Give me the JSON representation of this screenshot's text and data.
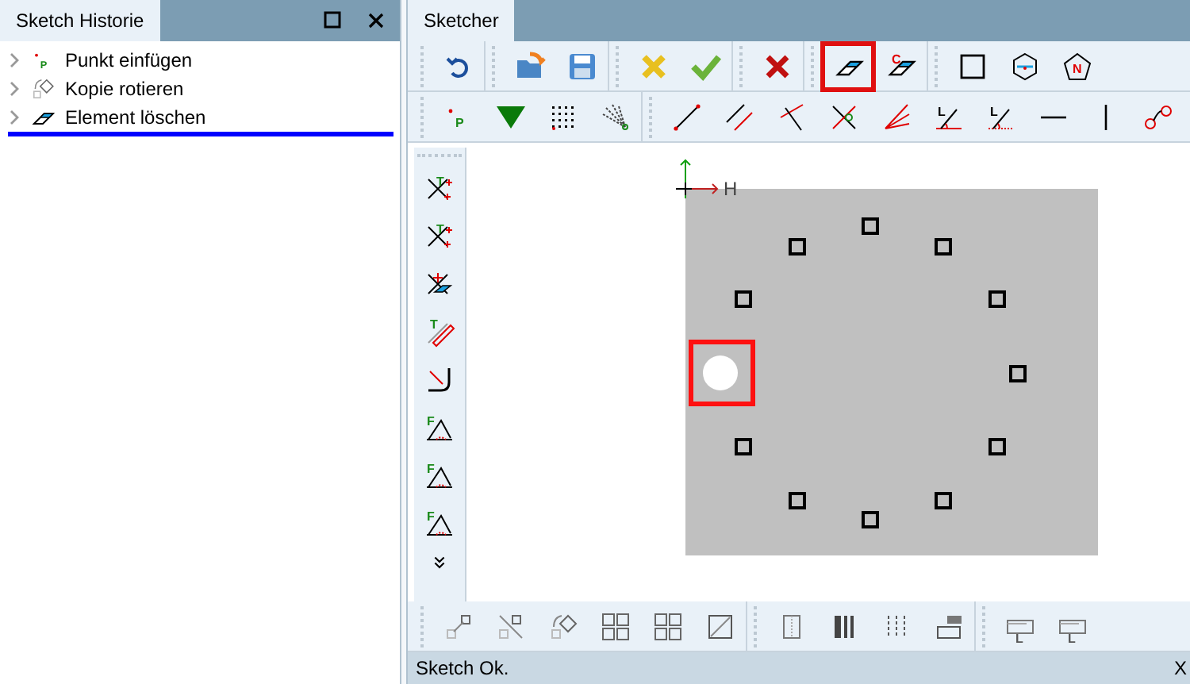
{
  "history_panel": {
    "title": "Sketch Historie",
    "items": [
      {
        "label": "Punkt einfügen",
        "kind": "point",
        "letter": "P",
        "expanded": false,
        "selected": false
      },
      {
        "label": "Kopie rotieren",
        "kind": "rotate",
        "expanded": false,
        "selected": false
      },
      {
        "label": "Element löschen",
        "kind": "eraser",
        "expanded": false,
        "selected": true
      }
    ]
  },
  "sketcher": {
    "tab": "Sketcher",
    "toolbar_1": [
      [
        {
          "kind": "undo"
        }
      ],
      [
        {
          "kind": "open"
        },
        {
          "kind": "save"
        }
      ],
      [
        {
          "kind": "cancel"
        },
        {
          "kind": "check"
        }
      ],
      [
        {
          "kind": "delete"
        }
      ],
      [
        {
          "kind": "eraser",
          "highlighted": true
        },
        {
          "kind": "eraser-c",
          "letter": "C",
          "highlighted": false
        }
      ],
      [
        {
          "kind": "square"
        },
        {
          "kind": "hexagon"
        },
        {
          "kind": "pentagon",
          "letter": "N"
        }
      ]
    ],
    "toolbar_2": [
      [
        {
          "kind": "point",
          "letter": "P"
        },
        {
          "kind": "triangle"
        },
        {
          "kind": "grid"
        },
        {
          "kind": "fan"
        }
      ],
      [
        {
          "kind": "line"
        },
        {
          "kind": "parallel"
        },
        {
          "kind": "perp"
        },
        {
          "kind": "cross"
        },
        {
          "kind": "rays"
        },
        {
          "kind": "angle",
          "letter": "L"
        },
        {
          "kind": "angle-dotted",
          "letter": "L"
        },
        {
          "kind": "hline"
        },
        {
          "kind": "vline"
        },
        {
          "kind": "circles"
        }
      ]
    ],
    "side_toolbar": [
      {
        "kind": "trim",
        "letter": "T"
      },
      {
        "kind": "trim",
        "letter": "T"
      },
      {
        "kind": "trim-erase"
      },
      {
        "kind": "offset",
        "letter": "T"
      },
      {
        "kind": "fillet"
      },
      {
        "kind": "chamfer",
        "letter": "F"
      },
      {
        "kind": "chamfer",
        "letter": "F"
      },
      {
        "kind": "chamfer",
        "letter": "F"
      },
      {
        "kind": "more"
      }
    ],
    "bottom_toolbar": [
      [
        {
          "kind": "move"
        },
        {
          "kind": "mirror"
        },
        {
          "kind": "rotate"
        },
        {
          "kind": "array"
        },
        {
          "kind": "array"
        },
        {
          "kind": "scale"
        }
      ],
      [
        {
          "kind": "panel"
        },
        {
          "kind": "bars"
        },
        {
          "kind": "dashes"
        },
        {
          "kind": "stamp"
        }
      ],
      [
        {
          "kind": "frame",
          "letter": "L"
        },
        {
          "kind": "frame",
          "letter": "L"
        }
      ]
    ],
    "canvas": {
      "axis_label": "H",
      "selection_highlighted": true
    },
    "status_bar": {
      "text": "Sketch Ok.",
      "right": "X"
    }
  }
}
